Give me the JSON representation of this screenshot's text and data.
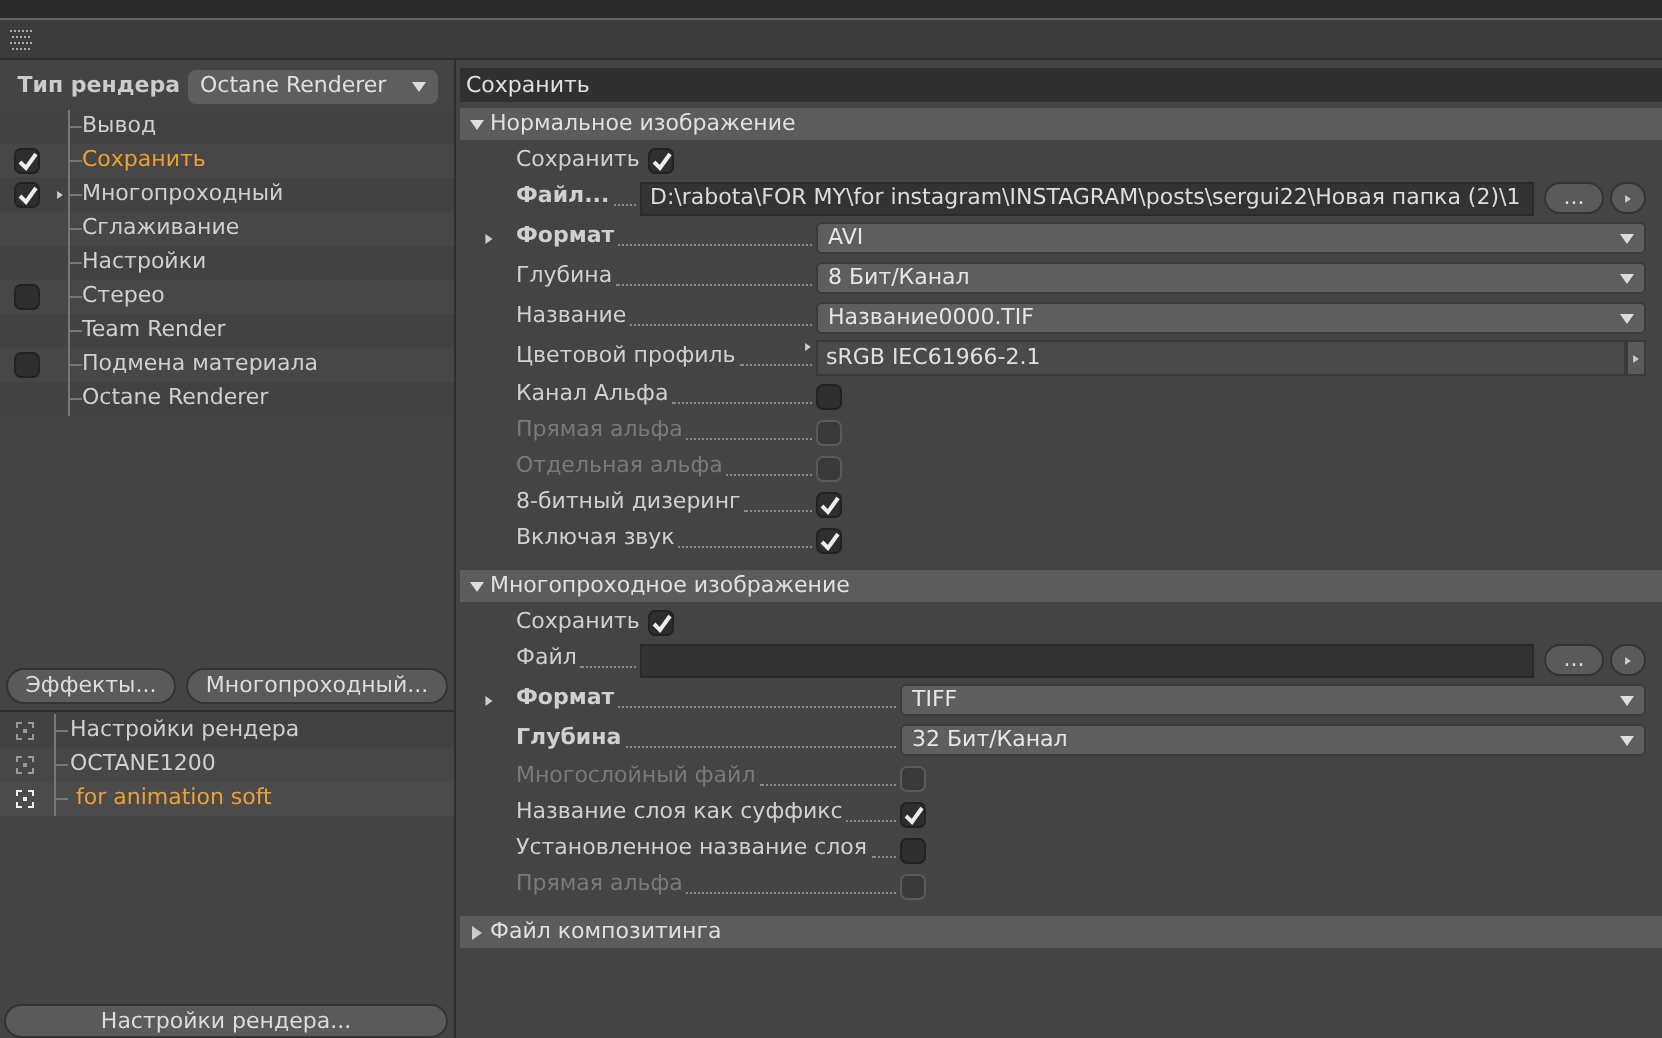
{
  "render_type": {
    "label": "Тип рендера",
    "value": "Octane Renderer"
  },
  "tree": [
    {
      "label": "Вывод",
      "kind": "plain",
      "selected": false
    },
    {
      "label": "Сохранить",
      "kind": "checkbox",
      "checked": true,
      "selected": true
    },
    {
      "label": "Многопроходный",
      "kind": "checkbox",
      "checked": true,
      "selected": false,
      "expandable": true
    },
    {
      "label": "Сглаживание",
      "kind": "plain",
      "selected": false
    },
    {
      "label": "Настройки",
      "kind": "plain",
      "selected": false
    },
    {
      "label": "Стерео",
      "kind": "checkbox",
      "checked": false,
      "selected": false
    },
    {
      "label": "Team Render",
      "kind": "plain",
      "selected": false
    },
    {
      "label": "Подмена материала",
      "kind": "checkbox",
      "checked": false,
      "selected": false
    },
    {
      "label": "Octane Renderer",
      "kind": "plain",
      "selected": false
    }
  ],
  "left_buttons": [
    "Эффекты...",
    "Многопроходный..."
  ],
  "presets": [
    {
      "label": "Настройки рендера",
      "selected": false
    },
    {
      "label": "OCTANE1200",
      "selected": false
    },
    {
      "label": "for animation soft",
      "selected": true
    }
  ],
  "bottom_button": "Настройки рендера...",
  "panel_title": "Сохранить",
  "sections": [
    {
      "title": "Нормальное изображение",
      "expanded": true,
      "rows": [
        {
          "kind": "toggle",
          "label": "Сохранить",
          "checked": true
        },
        {
          "kind": "file",
          "label": "Файл...",
          "bold": true,
          "value": "D:\\rabota\\FOR MY\\for instagram\\INSTAGRAM\\posts\\sergui22\\Новая папка (2)\\1",
          "button": "..."
        },
        {
          "kind": "dropdown",
          "label": "Формат",
          "bold": true,
          "expandable": true,
          "value": "AVI"
        },
        {
          "kind": "dropdown",
          "label": "Глубина",
          "value": "8 Бит/Канал"
        },
        {
          "kind": "dropdown",
          "label": "Название",
          "value": "Название0000.TIF"
        },
        {
          "kind": "profile",
          "label": "Цветовой профиль",
          "expandable": true,
          "value": "sRGB IEC61966-2.1"
        },
        {
          "kind": "checkbox",
          "label": "Канал Альфа",
          "checked": false,
          "disabled": false
        },
        {
          "kind": "checkbox",
          "label": "Прямая альфа",
          "checked": false,
          "disabled": true
        },
        {
          "kind": "checkbox",
          "label": "Отдельная альфа",
          "checked": false,
          "disabled": true
        },
        {
          "kind": "checkbox",
          "label": "8-битный дизеринг",
          "checked": true,
          "disabled": false
        },
        {
          "kind": "checkbox",
          "label": "Включая звук",
          "checked": true,
          "disabled": false
        }
      ]
    },
    {
      "title": "Многопроходное изображение",
      "expanded": true,
      "rows": [
        {
          "kind": "toggle",
          "label": "Сохранить",
          "checked": true
        },
        {
          "kind": "file",
          "label": "Файл",
          "bold": false,
          "button": "..."
        },
        {
          "kind": "dropdown",
          "label": "Формат",
          "bold": true,
          "expandable": true,
          "value": "TIFF"
        },
        {
          "kind": "dropdown",
          "label": "Глубина",
          "bold": true,
          "value": "32 Бит/Канал"
        },
        {
          "kind": "checkbox",
          "label": "Многослойный файл",
          "checked": false,
          "disabled": true
        },
        {
          "kind": "checkbox",
          "label": "Название слоя как суффикс",
          "checked": true,
          "disabled": false
        },
        {
          "kind": "checkbox",
          "label": "Установленное название слоя",
          "checked": false,
          "disabled": false
        },
        {
          "kind": "checkbox",
          "label": "Прямая альфа",
          "checked": false,
          "disabled": true
        }
      ]
    },
    {
      "title": "Файл композитинга",
      "expanded": false
    }
  ]
}
